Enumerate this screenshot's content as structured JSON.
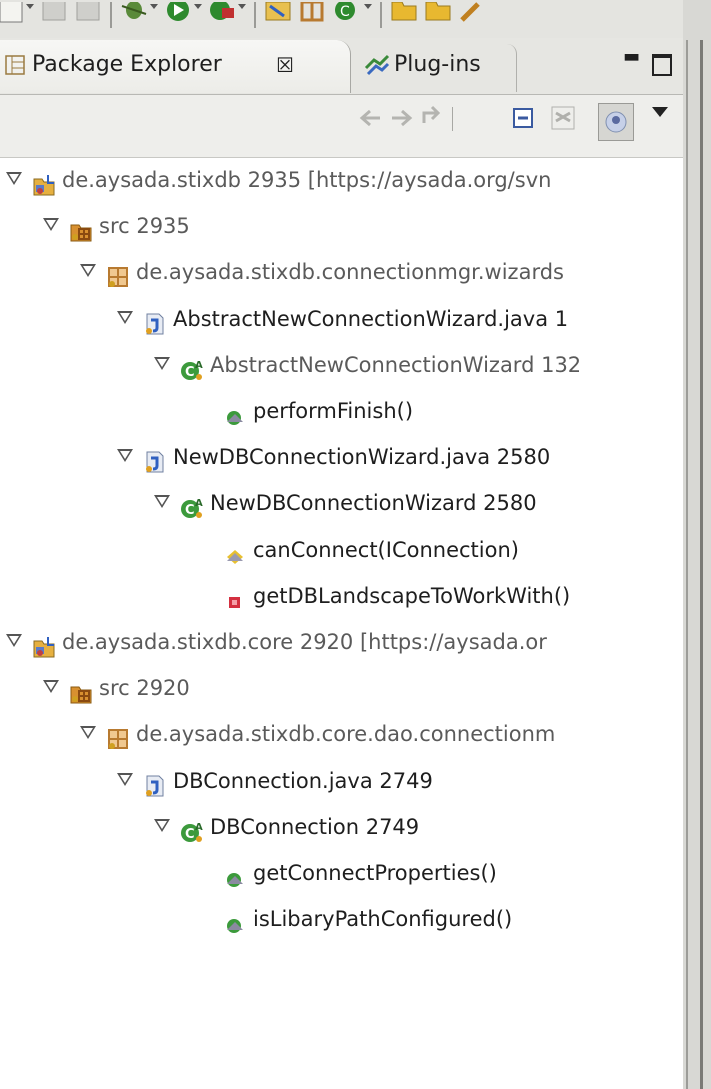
{
  "tabs": {
    "package_explorer": "Package Explorer",
    "close_glyph": "☒",
    "plugins": "Plug-ins"
  },
  "tree": [
    {
      "id": "proj1",
      "label": "de.aysada.stixdb 2935 [https://aysada.org/svn",
      "kind": "project",
      "indent": 0
    },
    {
      "id": "src1",
      "label": "src 2935",
      "kind": "source-folder",
      "indent": 1
    },
    {
      "id": "pkg1",
      "label": "de.aysada.stixdb.connectionmgr.wizards",
      "kind": "package",
      "indent": 2
    },
    {
      "id": "file1",
      "label": "AbstractNewConnectionWizard.java 1",
      "kind": "java-file",
      "indent": 3
    },
    {
      "id": "class1",
      "label": "AbstractNewConnectionWizard 132",
      "kind": "abstract-class",
      "indent": 4
    },
    {
      "id": "m1",
      "label": "performFinish()",
      "kind": "method-public",
      "indent": 5
    },
    {
      "id": "file2",
      "label": "NewDBConnectionWizard.java 2580",
      "kind": "java-file",
      "indent": 3
    },
    {
      "id": "class2",
      "label": "NewDBConnectionWizard 2580",
      "kind": "class",
      "indent": 4
    },
    {
      "id": "m2",
      "label": "canConnect(IConnection)",
      "kind": "method-protected",
      "indent": 5
    },
    {
      "id": "m3",
      "label": "getDBLandscapeToWorkWith()",
      "kind": "method-private",
      "indent": 5
    },
    {
      "id": "proj2",
      "label": "de.aysada.stixdb.core 2920 [https://aysada.or",
      "kind": "project",
      "indent": 0
    },
    {
      "id": "src2",
      "label": "src 2920",
      "kind": "source-folder",
      "indent": 1
    },
    {
      "id": "pkg2",
      "label": "de.aysada.stixdb.core.dao.connectionm",
      "kind": "package",
      "indent": 2
    },
    {
      "id": "file3",
      "label": "DBConnection.java 2749",
      "kind": "java-file",
      "indent": 3
    },
    {
      "id": "class3",
      "label": "DBConnection 2749",
      "kind": "class",
      "indent": 4
    },
    {
      "id": "m4",
      "label": "getConnectProperties()",
      "kind": "method-public",
      "indent": 5
    },
    {
      "id": "m5",
      "label": "isLibaryPathConfigured()",
      "kind": "method-public",
      "indent": 5
    }
  ],
  "colors": {
    "tree_bg": "#ffffff",
    "method_public": "#3c9a3c",
    "method_protected": "#e8c030",
    "method_private": "#d43040",
    "package": "#b87a30",
    "source_folder": "#d89030"
  }
}
